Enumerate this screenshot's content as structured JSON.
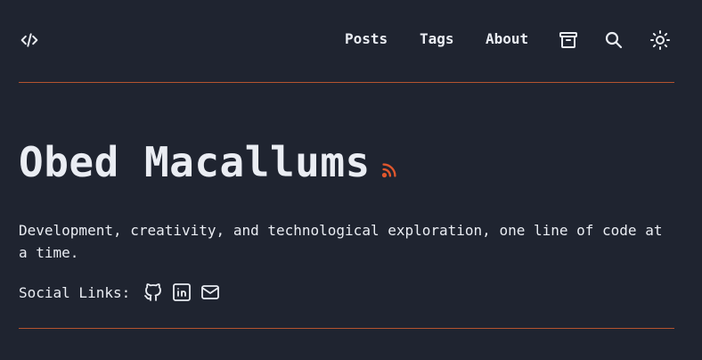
{
  "nav": {
    "logo_icon": "code-icon",
    "links": [
      "Posts",
      "Tags",
      "About"
    ],
    "archive_icon": "archive-icon",
    "search_icon": "search-icon",
    "theme_icon": "sun-icon"
  },
  "hero": {
    "title": "Obed Macallums",
    "rss_icon": "rss-icon",
    "description": "Development, creativity, and technological exploration, one line of code at a time.",
    "social_label": "Social Links:",
    "social_icons": [
      "github-icon",
      "linkedin-icon",
      "mail-icon"
    ]
  },
  "colors": {
    "background": "#1f2430",
    "text": "#eaedf3",
    "accent": "#e0572d"
  }
}
